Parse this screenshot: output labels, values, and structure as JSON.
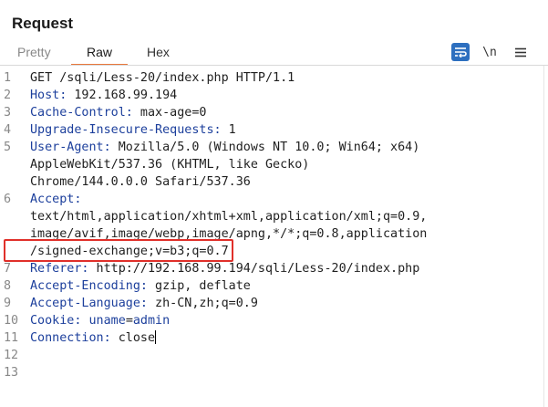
{
  "panel": {
    "title": "Request"
  },
  "tabs": {
    "pretty": "Pretty",
    "raw": "Raw",
    "hex": "Hex",
    "active": "Raw"
  },
  "toolbar": {
    "wrap_icon": "word-wrap-icon",
    "newline_label": "\\n",
    "menu_icon": "hamburger-menu-icon"
  },
  "colors": {
    "accent": "#e8773a",
    "header_name": "#1c3f9c",
    "highlight": "#e0302a",
    "wrap_button": "#2d6fbf"
  },
  "lines": [
    {
      "num": "1",
      "name": "",
      "value": "GET /sqli/Less-20/index.php HTTP/1.1"
    },
    {
      "num": "2",
      "name": "Host:",
      "value": " 192.168.99.194"
    },
    {
      "num": "3",
      "name": "Cache-Control:",
      "value": " max-age=0"
    },
    {
      "num": "4",
      "name": "Upgrade-Insecure-Requests:",
      "value": " 1"
    },
    {
      "num": "5",
      "name": "User-Agent:",
      "value": " Mozilla/5.0 (Windows NT 10.0; Win64; x64)"
    },
    {
      "num": "",
      "name": "",
      "value": "AppleWebKit/537.36 (KHTML, like Gecko)"
    },
    {
      "num": "",
      "name": "",
      "value": "Chrome/144.0.0.0 Safari/537.36"
    },
    {
      "num": "6",
      "name": "Accept:",
      "value": ""
    },
    {
      "num": "",
      "name": "",
      "value": "text/html,application/xhtml+xml,application/xml;q=0.9,"
    },
    {
      "num": "",
      "name": "",
      "value": "image/avif,image/webp,image/apng,*/*;q=0.8,application"
    },
    {
      "num": "",
      "name": "",
      "value": "/signed-exchange;v=b3;q=0.7"
    },
    {
      "num": "7",
      "name": "Referer:",
      "value": " http://192.168.99.194/sqli/Less-20/index.php"
    },
    {
      "num": "8",
      "name": "Accept-Encoding:",
      "value": " gzip, deflate"
    },
    {
      "num": "9",
      "name": "Accept-Language:",
      "value": " zh-CN,zh;q=0.9"
    },
    {
      "num": "10",
      "name": "Cookie:",
      "value": " ",
      "cookie_name": "uname",
      "cookie_eq": "=",
      "cookie_value": "admin"
    },
    {
      "num": "11",
      "name": "Connection:",
      "value": " close"
    },
    {
      "num": "12",
      "name": "",
      "value": ""
    },
    {
      "num": "13",
      "name": "",
      "value": ""
    }
  ]
}
